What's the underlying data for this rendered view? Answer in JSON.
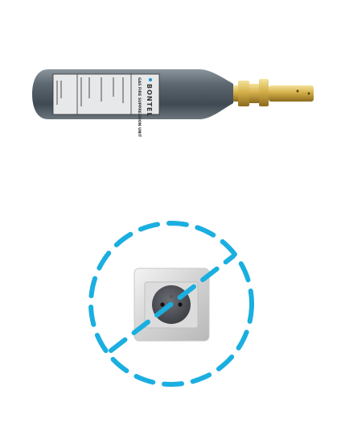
{
  "cylinder": {
    "brand": "BONTEL",
    "product_line": "GAS FIRE SUPPRESSION UNIT"
  },
  "no_power_symbol": {
    "accent_color": "#1aafe0"
  }
}
